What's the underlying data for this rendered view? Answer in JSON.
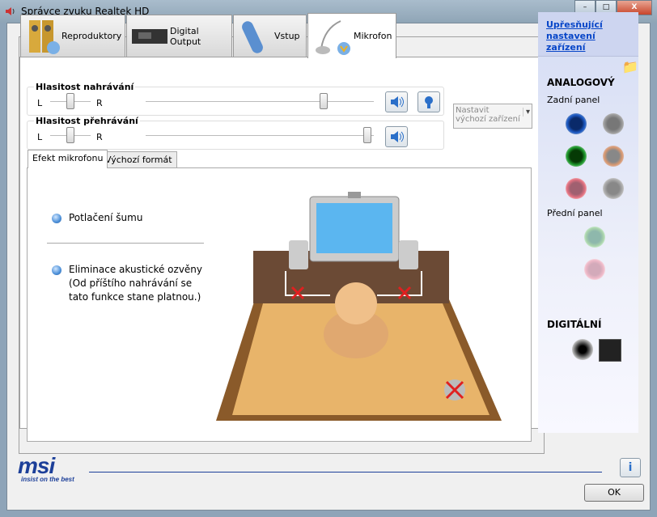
{
  "window": {
    "title": "Správce zvuku Realtek HD",
    "minimize": "–",
    "maximize": "□",
    "close": "X"
  },
  "tabs": [
    {
      "label": "Reproduktory"
    },
    {
      "label": "Digital Output"
    },
    {
      "label": "Vstup"
    },
    {
      "label": "Mikrofon"
    }
  ],
  "recording": {
    "label": "Hlasitost nahrávání",
    "left": "L",
    "right": "R",
    "balance": 0.5,
    "volume": 0.78
  },
  "playback": {
    "label": "Hlasitost přehrávání",
    "left": "L",
    "right": "R",
    "balance": 0.5,
    "volume": 0.98
  },
  "default_device": {
    "line1": "Nastavit",
    "line2": "výchozí zařízení"
  },
  "subtabs": [
    {
      "label": "Efekt mikrofonu"
    },
    {
      "label": "Výchozí formát"
    }
  ],
  "effects": [
    {
      "label": "Potlačení šumu"
    },
    {
      "label": "Eliminace akustické ozvěny",
      "note1": "(Od příštího nahrávání se",
      "note2": "tato funkce stane platnou.)"
    }
  ],
  "side": {
    "link1": "Upřesňující",
    "link2": "nastavení zařízení",
    "analog": "ANALOGOVÝ",
    "rear": "Zadní panel",
    "front": "Přední panel",
    "digital": "DIGITÁLNÍ"
  },
  "brand": {
    "logo": "msi",
    "tagline": "insist on the best"
  },
  "ok": "OK",
  "colors": {
    "accent": "#0645c8"
  }
}
